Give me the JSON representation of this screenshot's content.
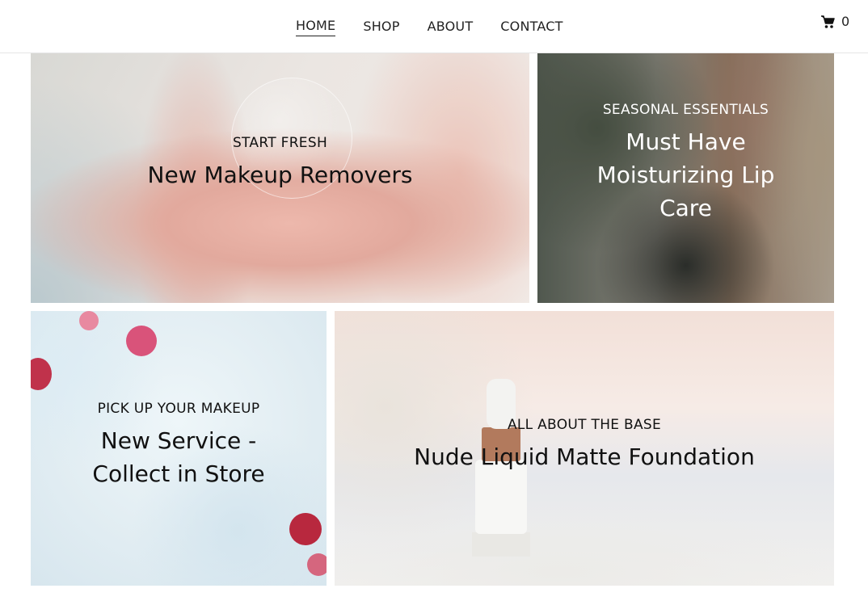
{
  "nav": {
    "items": [
      {
        "label": "HOME",
        "active": true
      },
      {
        "label": "SHOP",
        "active": false
      },
      {
        "label": "ABOUT",
        "active": false
      },
      {
        "label": "CONTACT",
        "active": false
      }
    ]
  },
  "cart": {
    "icon": "cart-icon",
    "count": "0"
  },
  "tiles": [
    {
      "eyebrow": "START FRESH",
      "headline": "New Makeup Removers"
    },
    {
      "eyebrow": "SEASONAL ESSENTIALS",
      "headline": "Must Have Moisturizing Lip Care"
    },
    {
      "eyebrow": "PICK UP YOUR MAKEUP",
      "headline": "New Service - Collect in Store"
    },
    {
      "eyebrow": "ALL ABOUT THE BASE",
      "headline": "Nude Liquid Matte Foundation"
    }
  ],
  "colors": {
    "text_dark": "#111111",
    "text_light": "#ffffff",
    "header_border": "#e6e6e6"
  }
}
